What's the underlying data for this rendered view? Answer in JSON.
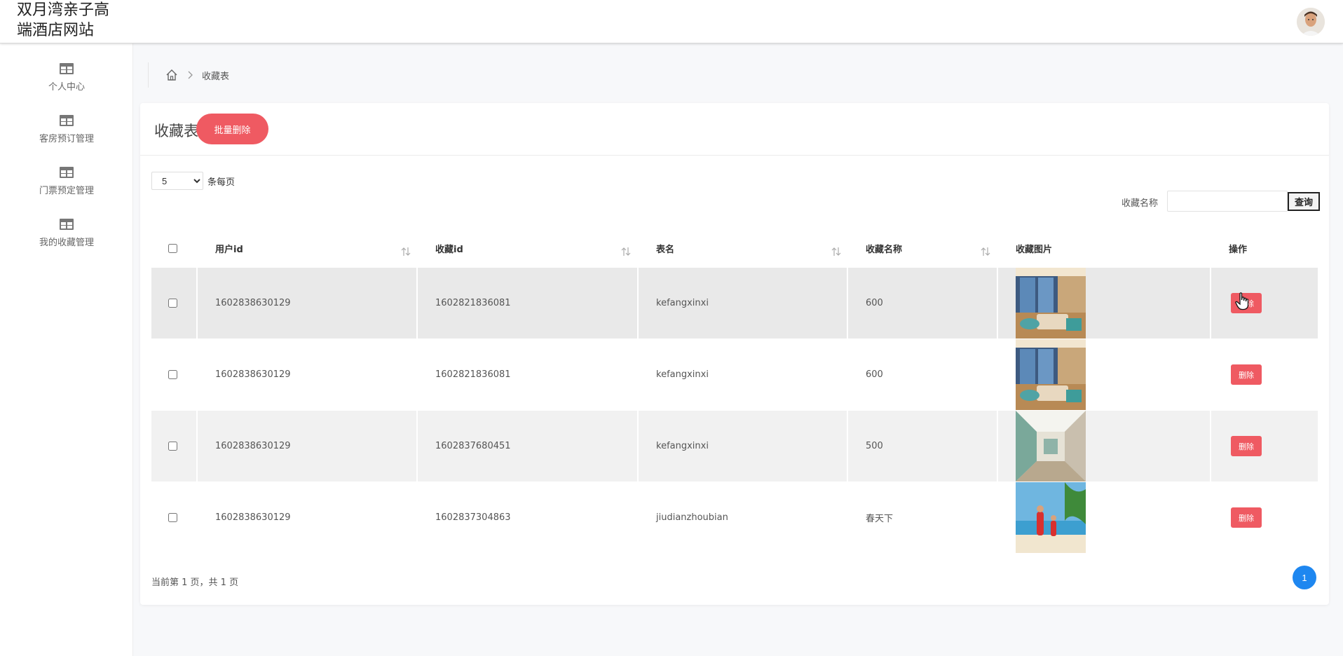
{
  "site": {
    "title": "双月湾亲子高端酒店网站"
  },
  "sidebar": {
    "items": [
      {
        "label": "个人中心",
        "icon": "table-icon"
      },
      {
        "label": "客房预订管理",
        "icon": "table-icon"
      },
      {
        "label": "门票预定管理",
        "icon": "table-icon"
      },
      {
        "label": "我的收藏管理",
        "icon": "table-icon"
      }
    ]
  },
  "breadcrumb": {
    "current": "收藏表"
  },
  "card": {
    "title": "收藏表",
    "batch_delete_label": "批量删除"
  },
  "pager": {
    "page_size": "5",
    "page_size_suffix": "条每页",
    "summary": "当前第 1 页，共 1 页",
    "current_page": "1"
  },
  "search": {
    "label": "收藏名称",
    "value": "",
    "button_label": "查询"
  },
  "table": {
    "columns": [
      "用户id",
      "收藏id",
      "表名",
      "收藏名称",
      "收藏图片",
      "操作"
    ],
    "rows": [
      {
        "user_id": "1602838630129",
        "fav_id": "1602821836081",
        "table_name": "kefangxinxi",
        "fav_name": "600",
        "image": "hotel-room-photo",
        "action": "删除"
      },
      {
        "user_id": "1602838630129",
        "fav_id": "1602821836081",
        "table_name": "kefangxinxi",
        "fav_name": "600",
        "image": "hotel-room-photo",
        "action": "删除"
      },
      {
        "user_id": "1602838630129",
        "fav_id": "1602837680451",
        "table_name": "kefangxinxi",
        "fav_name": "500",
        "image": "hotel-corridor-photo",
        "action": "删除"
      },
      {
        "user_id": "1602838630129",
        "fav_id": "1602837304863",
        "table_name": "jiudianzhoubian",
        "fav_name": "春天下",
        "image": "beach-family-photo",
        "action": "删除"
      }
    ]
  },
  "colors": {
    "accent_red": "#ef5a62",
    "pager_blue": "#1e87f0"
  }
}
